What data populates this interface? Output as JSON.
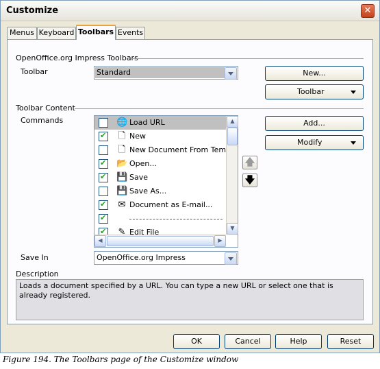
{
  "window": {
    "title": "Customize",
    "close_glyph": "✕"
  },
  "tabs": [
    {
      "label": "Menus",
      "active": false
    },
    {
      "label": "Keyboard",
      "active": false
    },
    {
      "label": "Toolbars",
      "active": true
    },
    {
      "label": "Events",
      "active": false
    }
  ],
  "toolbars_group": {
    "header": "OpenOffice.org Impress Toolbars",
    "toolbar_label": "Toolbar",
    "toolbar_value": "Standard",
    "new_button": "New...",
    "toolbar_button": "Toolbar"
  },
  "content_group": {
    "header": "Toolbar Content",
    "commands_label": "Commands",
    "add_button": "Add...",
    "modify_button": "Modify",
    "commands": [
      {
        "label": "Load URL",
        "checked": false,
        "icon": "globe-icon",
        "glyph": "🌐",
        "highlighted": true
      },
      {
        "label": "New",
        "checked": true,
        "icon": "document-icon",
        "glyph": "🗋",
        "highlighted": false
      },
      {
        "label": "New Document From Template",
        "checked": false,
        "icon": "document-icon",
        "glyph": "🗋",
        "highlighted": false
      },
      {
        "label": "Open...",
        "checked": true,
        "icon": "folder-icon",
        "glyph": "📂",
        "highlighted": false
      },
      {
        "label": "Save",
        "checked": true,
        "icon": "floppy-icon",
        "glyph": "💾",
        "highlighted": false
      },
      {
        "label": "Save As...",
        "checked": false,
        "icon": "floppy-icon",
        "glyph": "💾",
        "highlighted": false
      },
      {
        "label": "Document as E-mail...",
        "checked": true,
        "icon": "email-icon",
        "glyph": "✉",
        "highlighted": false
      },
      {
        "label": "",
        "checked": true,
        "icon": "separator",
        "glyph": "",
        "highlighted": false,
        "separator": true
      },
      {
        "label": "Edit File",
        "checked": true,
        "icon": "edit-icon",
        "glyph": "✎",
        "highlighted": false
      }
    ],
    "move_up_glyph": "🡅",
    "move_down_glyph": "🡇"
  },
  "save_in": {
    "label": "Save In",
    "value": "OpenOffice.org Impress"
  },
  "description": {
    "label": "Description",
    "text": "Loads a document specified by a URL. You can type a new URL or select one that is already registered."
  },
  "footer": {
    "ok": "OK",
    "cancel": "Cancel",
    "help": "Help",
    "reset": "Reset"
  },
  "caption": "Figure 194. The Toolbars page of the Customize window"
}
